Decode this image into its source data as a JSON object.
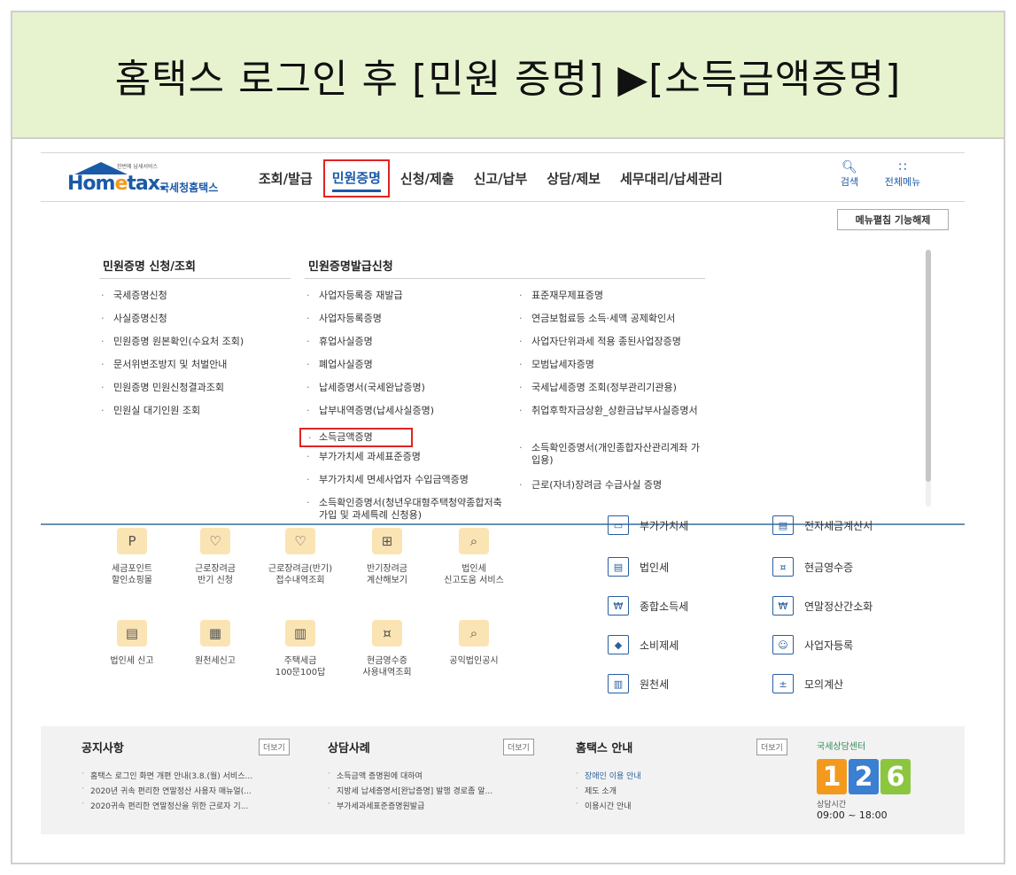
{
  "banner": {
    "title": "홈택스 로그인 후 [민원 증명] ▶[소득금액증명]"
  },
  "header": {
    "logo_sub": "한번에 납세서비스",
    "logo_word_a": "Hom",
    "logo_word_e": "e",
    "logo_word_b": "tax.",
    "logo_kr": "국세청홈택스",
    "nav": [
      "조회/발급",
      "민원증명",
      "신청/제출",
      "신고/납부",
      "상담/제보",
      "세무대리/납세관리"
    ],
    "search_label": "검색",
    "search_icon": "search-icon",
    "allmenu_label": "전체메뉴",
    "allmenu_icon": "grid-icon"
  },
  "release_button": "메뉴펼침 기능해제",
  "menu": {
    "col1_title": "민원증명 신청/조회",
    "col1_items": [
      "국세증명신청",
      "사실증명신청",
      "민원증명 원본확인(수요처 조회)",
      "문서위변조방지 및 처벌안내",
      "민원증명 민원신청결과조회",
      "민원실 대기인원 조회"
    ],
    "col2_title": "민원증명발급신청",
    "col2_items": [
      "사업자등록증 재발급",
      "사업자등록증명",
      "휴업사실증명",
      "폐업사실증명",
      "납세증명서(국세완납증명)",
      "납부내역증명(납세사실증명)",
      "소득금액증명",
      "부가가치세 과세표준증명",
      "부가가치세 면세사업자 수입금액증명",
      "소득확인증명서(청년우대형주택청약종합저축 가입 및 과세특례 신청용)"
    ],
    "col3_items": [
      "표준재무제표증명",
      "연금보험료등 소득·세액 공제확인서",
      "사업자단위과세 적용 종된사업장증명",
      "모범납세자증명",
      "국세납세증명 조회(정부관리기관용)",
      "취업후학자금상환_상환금납부사실증명서",
      "소득확인증명서(개인종합자산관리계좌 가입용)",
      "근로(자녀)장려금 수급사실 증명"
    ]
  },
  "services": {
    "row1": [
      "세금포인트\n할인쇼핑몰",
      "근로장려금\n반기 신청",
      "근로장려금(반기)\n접수내역조회",
      "반기장려금\n계산해보기",
      "법인세\n신고도움 서비스"
    ],
    "row2": [
      "법인세 신고",
      "원천세신고",
      "주택세금\n100문100답",
      "현금영수증\n사용내역조회",
      "공익법인공시"
    ],
    "right": [
      "부가가치세",
      "전자세금계산서",
      "법인세",
      "현금영수증",
      "종합소득세",
      "연말정산간소화",
      "소비제세",
      "사업자등록",
      "원천세",
      "모의계산"
    ]
  },
  "footer": {
    "notice_title": "공지사항",
    "notice_more": "더보기",
    "notice_items": [
      "홈택스 로그인 화면 개편 안내(3.8.(월) 서비스...",
      "2020년 귀속 편리한 연말정산 사용자 매뉴얼(...",
      "2020귀속 편리한 연말정산을 위한 근로자 기..."
    ],
    "consult_title": "상담사례",
    "consult_more": "더보기",
    "consult_items": [
      "소득금액 증명원에 대하여",
      "지방세 납세증명서[완납증명] 발행 경로좀 알...",
      "부가세과세표준증명원발급"
    ],
    "guide_title": "홈택스 안내",
    "guide_more": "더보기",
    "guide_items": [
      "장애인 이용 안내",
      "제도 소개",
      "이용시간 안내"
    ],
    "center_tag": "국세상담센터",
    "center_digits": [
      "1",
      "2",
      "6"
    ],
    "center_colors": [
      "#f39a1e",
      "#3a7fd0",
      "#8cc63f"
    ],
    "hours_label": "상담시간",
    "hours": "09:00 ~ 18:00"
  }
}
